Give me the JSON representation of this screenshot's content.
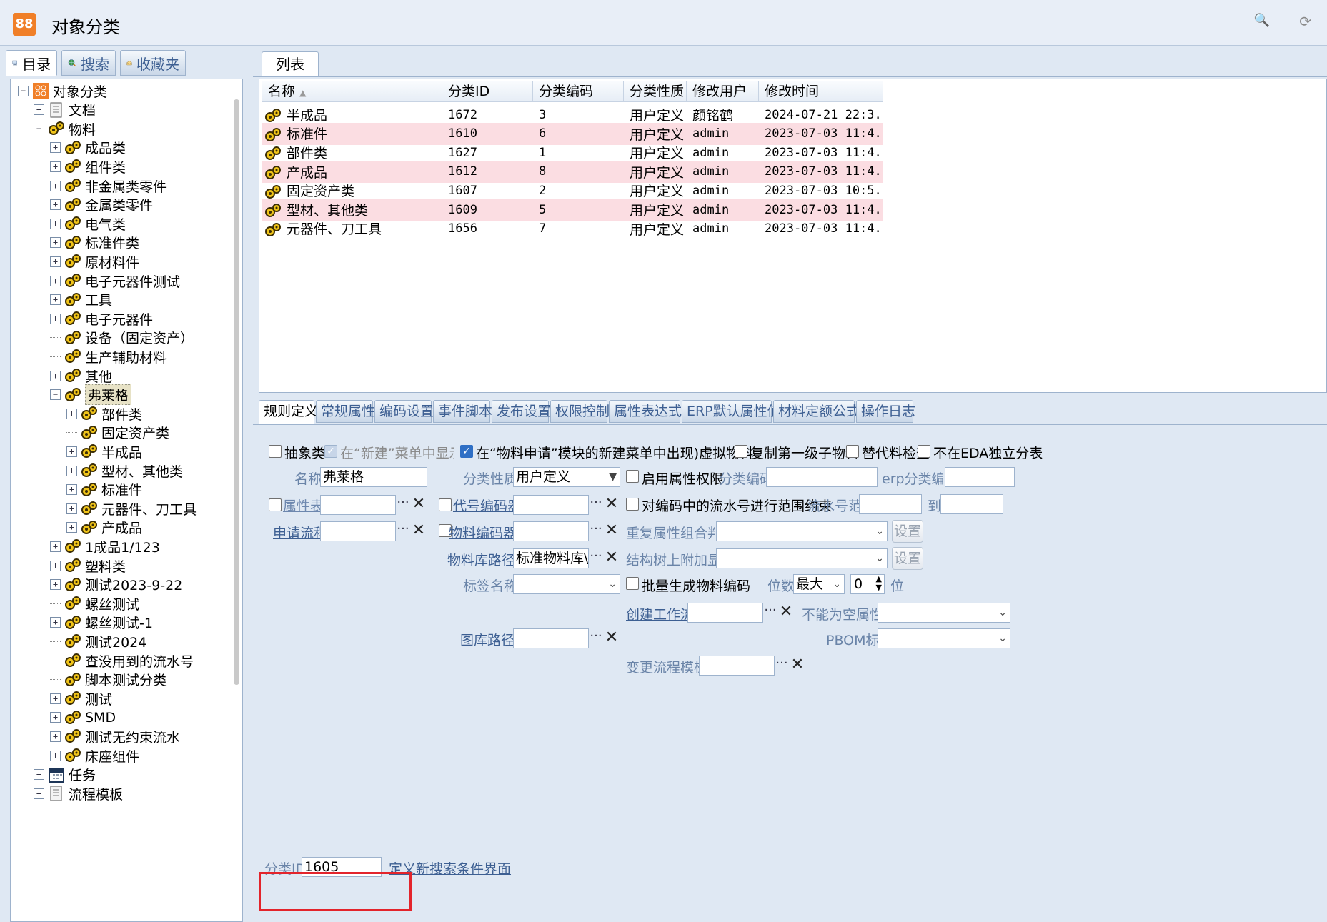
{
  "window": {
    "title": "对象分类",
    "icon": "grid-icon",
    "icon_glyph": "88"
  },
  "toolbar": {
    "search_icon": "search-icon",
    "refresh_icon": "refresh-icon"
  },
  "left_tabs": [
    {
      "label": "目录",
      "icon": "computer-icon",
      "active": true
    },
    {
      "label": "搜索",
      "icon": "globe-search-icon",
      "active": false
    },
    {
      "label": "收藏夹",
      "icon": "favorites-icon",
      "active": false
    }
  ],
  "tree": [
    {
      "label": "对象分类",
      "level": 0,
      "exp": "-",
      "icon": "grid-icon"
    },
    {
      "label": "文档",
      "level": 1,
      "exp": "+",
      "icon": "document-icon"
    },
    {
      "label": "物料",
      "level": 1,
      "exp": "-",
      "icon": "gears-icon"
    },
    {
      "label": "成品类",
      "level": 2,
      "exp": "+",
      "icon": "gears-icon"
    },
    {
      "label": "组件类",
      "level": 2,
      "exp": "+",
      "icon": "gears-icon"
    },
    {
      "label": "非金属类零件",
      "level": 2,
      "exp": "+",
      "icon": "gears-icon"
    },
    {
      "label": "金属类零件",
      "level": 2,
      "exp": "+",
      "icon": "gears-icon"
    },
    {
      "label": "电气类",
      "level": 2,
      "exp": "+",
      "icon": "gears-icon"
    },
    {
      "label": "标准件类",
      "level": 2,
      "exp": "+",
      "icon": "gears-icon"
    },
    {
      "label": "原材料件",
      "level": 2,
      "exp": "+",
      "icon": "gears-icon"
    },
    {
      "label": "电子元器件测试",
      "level": 2,
      "exp": "+",
      "icon": "gears-icon"
    },
    {
      "label": "工具",
      "level": 2,
      "exp": "+",
      "icon": "gears-icon"
    },
    {
      "label": "电子元器件",
      "level": 2,
      "exp": "+",
      "icon": "gears-icon"
    },
    {
      "label": "设备（固定资产）",
      "level": 2,
      "exp": "",
      "icon": "gears-icon"
    },
    {
      "label": "生产辅助材料",
      "level": 2,
      "exp": "",
      "icon": "gears-icon"
    },
    {
      "label": "其他",
      "level": 2,
      "exp": "+",
      "icon": "gears-icon"
    },
    {
      "label": "弗莱格",
      "level": 2,
      "exp": "-",
      "icon": "gears-icon",
      "selected": true
    },
    {
      "label": "部件类",
      "level": 3,
      "exp": "+",
      "icon": "gears-icon"
    },
    {
      "label": "固定资产类",
      "level": 3,
      "exp": "",
      "icon": "gears-icon"
    },
    {
      "label": "半成品",
      "level": 3,
      "exp": "+",
      "icon": "gears-icon"
    },
    {
      "label": "型材、其他类",
      "level": 3,
      "exp": "+",
      "icon": "gears-icon"
    },
    {
      "label": "标准件",
      "level": 3,
      "exp": "+",
      "icon": "gears-icon"
    },
    {
      "label": "元器件、刀工具",
      "level": 3,
      "exp": "+",
      "icon": "gears-icon"
    },
    {
      "label": "产成品",
      "level": 3,
      "exp": "+",
      "icon": "gears-icon"
    },
    {
      "label": "1成品1/123",
      "level": 2,
      "exp": "+",
      "icon": "gears-icon"
    },
    {
      "label": "塑料类",
      "level": 2,
      "exp": "+",
      "icon": "gears-icon"
    },
    {
      "label": "测试2023-9-22",
      "level": 2,
      "exp": "+",
      "icon": "gears-icon"
    },
    {
      "label": "螺丝测试",
      "level": 2,
      "exp": "",
      "icon": "gears-icon"
    },
    {
      "label": "螺丝测试-1",
      "level": 2,
      "exp": "+",
      "icon": "gears-icon"
    },
    {
      "label": "测试2024",
      "level": 2,
      "exp": "",
      "icon": "gears-icon"
    },
    {
      "label": "查没用到的流水号",
      "level": 2,
      "exp": "",
      "icon": "gears-icon"
    },
    {
      "label": "脚本测试分类",
      "level": 2,
      "exp": "",
      "icon": "gears-icon"
    },
    {
      "label": "测试",
      "level": 2,
      "exp": "+",
      "icon": "gears-icon"
    },
    {
      "label": "SMD",
      "level": 2,
      "exp": "+",
      "icon": "gears-icon"
    },
    {
      "label": "测试无约束流水",
      "level": 2,
      "exp": "+",
      "icon": "gears-icon"
    },
    {
      "label": "床座组件",
      "level": 2,
      "exp": "+",
      "icon": "gears-icon"
    },
    {
      "label": "任务",
      "level": 1,
      "exp": "+",
      "icon": "calendar-icon"
    },
    {
      "label": "流程模板",
      "level": 1,
      "exp": "+",
      "icon": "document-icon"
    }
  ],
  "list": {
    "tab": "列表",
    "columns": [
      "名称",
      "分类ID",
      "分类编码",
      "分类性质",
      "修改用户",
      "修改时间"
    ],
    "sort_indicator": "▲",
    "rows": [
      [
        "半成品",
        "1672",
        "3",
        "用户定义",
        "颜铭鹤",
        "2024-07-21 22:3..."
      ],
      [
        "标准件",
        "1610",
        "6",
        "用户定义",
        "admin",
        "2023-07-03 11:4..."
      ],
      [
        "部件类",
        "1627",
        "1",
        "用户定义",
        "admin",
        "2023-07-03 11:4..."
      ],
      [
        "产成品",
        "1612",
        "8",
        "用户定义",
        "admin",
        "2023-07-03 11:4..."
      ],
      [
        "固定资产类",
        "1607",
        "2",
        "用户定义",
        "admin",
        "2023-07-03 10:5..."
      ],
      [
        "型材、其他类",
        "1609",
        "5",
        "用户定义",
        "admin",
        "2023-07-03 11:4..."
      ],
      [
        "元器件、刀工具",
        "1656",
        "7",
        "用户定义",
        "admin",
        "2023-07-03 11:4..."
      ]
    ]
  },
  "detail_tabs": [
    "规则定义",
    "常规属性",
    "编码设置",
    "事件脚本",
    "发布设置",
    "权限控制",
    "属性表达式",
    "ERP默认属性值",
    "材料定额公式",
    "操作日志"
  ],
  "form": {
    "abstract_label": "抽象类",
    "show_new_menu_label": "在“新建”菜单中显示",
    "show_in_apply_label": "在“物料申请”模块的新建菜单中出现",
    "virtual_label": "虚拟物料",
    "copy_first_label": "复制第一级子物料",
    "substitute_label": "替代料检查",
    "not_eda_label": "不在EDA独立分表",
    "name_label": "名称",
    "name_value": "弗莱格",
    "nature_label": "分类性质",
    "nature_value": "用户定义",
    "enable_attr_perm_label": "启用属性权限",
    "class_code_label": "分类编码",
    "erp_code_label": "erp分类编码",
    "attr_table_label": "属性表",
    "code_encoder_label": "代号编码器",
    "range_constraint_label": "对编码中的流水号进行范围约束",
    "serial_range_label": "流水号范围",
    "to_label": "到",
    "apply_flow_label": "申请流程",
    "material_encoder_label": "物料编码器",
    "dup_attr_label": "重复属性组合判断",
    "set_label": "设置",
    "lib_path_label": "物料库路径",
    "lib_path_value": "标准物料库\\其",
    "struct_tree_label": "结构树上附加显示",
    "tag_name_label": "标签名称",
    "batch_gen_label": "批量生成物料编码",
    "digits_label": "位数",
    "digits_value": "最大",
    "digits_spin": "0",
    "digits_unit": "位",
    "create_wf_label": "创建工作流",
    "not_null_label": "不能为空属性",
    "drawing_path_label": "图库路径",
    "pbom_label": "PBOM标签",
    "change_flow_label": "变更流程模板",
    "class_id_label": "分类ID",
    "class_id_value": "1605",
    "define_search_label": "定义新搜索条件界面"
  }
}
